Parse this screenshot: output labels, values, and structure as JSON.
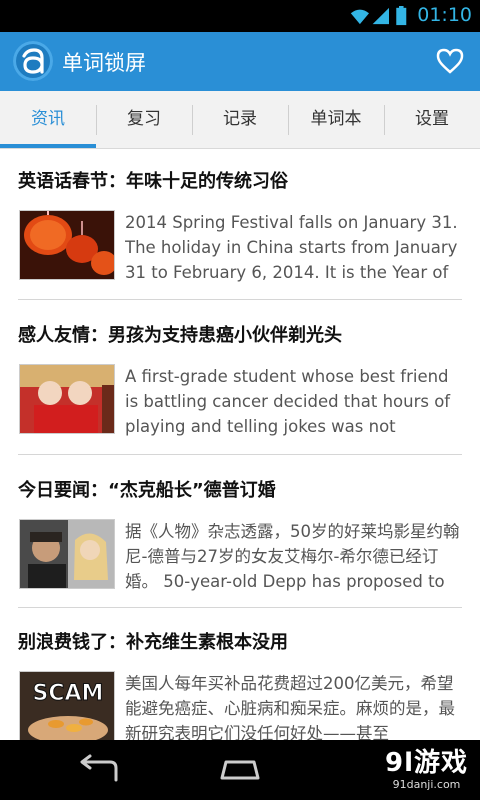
{
  "status_bar": {
    "time": "01:10"
  },
  "app": {
    "title": "单词锁屏"
  },
  "tabs": [
    {
      "label": "资讯",
      "active": true
    },
    {
      "label": "复习",
      "active": false
    },
    {
      "label": "记录",
      "active": false
    },
    {
      "label": "单词本",
      "active": false
    },
    {
      "label": "设置",
      "active": false
    }
  ],
  "articles": [
    {
      "headline": "英语话春节：年味十足的传统习俗",
      "summary": "2014 Spring Festival falls on January 31. The holiday in China starts from January 31 to February 6, 2014. It is the Year of the",
      "thumbnail": "red-lanterns-photo"
    },
    {
      "headline": "感人友情：男孩为支持患癌小伙伴剃光头",
      "summary": "A first-grade student whose best friend is battling cancer decided that hours of playing and telling jokes was not enough -",
      "thumbnail": "two-bald-boys-photo"
    },
    {
      "headline": "今日要闻：“杰克船长”德普订婚",
      "summary": "据《人物》杂志透露，50岁的好莱坞影星约翰尼-德普与27岁的女友艾梅尔-希尔德已经订婚。 50-year-old Depp has proposed to",
      "thumbnail": "couple-photo"
    },
    {
      "headline": "别浪费钱了：补充维生素根本没用",
      "summary": "美国人每年买补品花费超过200亿美元，希望能避免癌症、心脏病和痴呆症。麻烦的是，最新研究表明它们没任何好处——甚至",
      "thumbnail": "scam-pills-photo",
      "thumbnail_text": "SCAM"
    }
  ],
  "watermark": {
    "logo_text": "9l游戏",
    "site": "91danji.com"
  },
  "colors": {
    "accent": "#2a8fd6",
    "status_icons": "#33b5e5"
  }
}
